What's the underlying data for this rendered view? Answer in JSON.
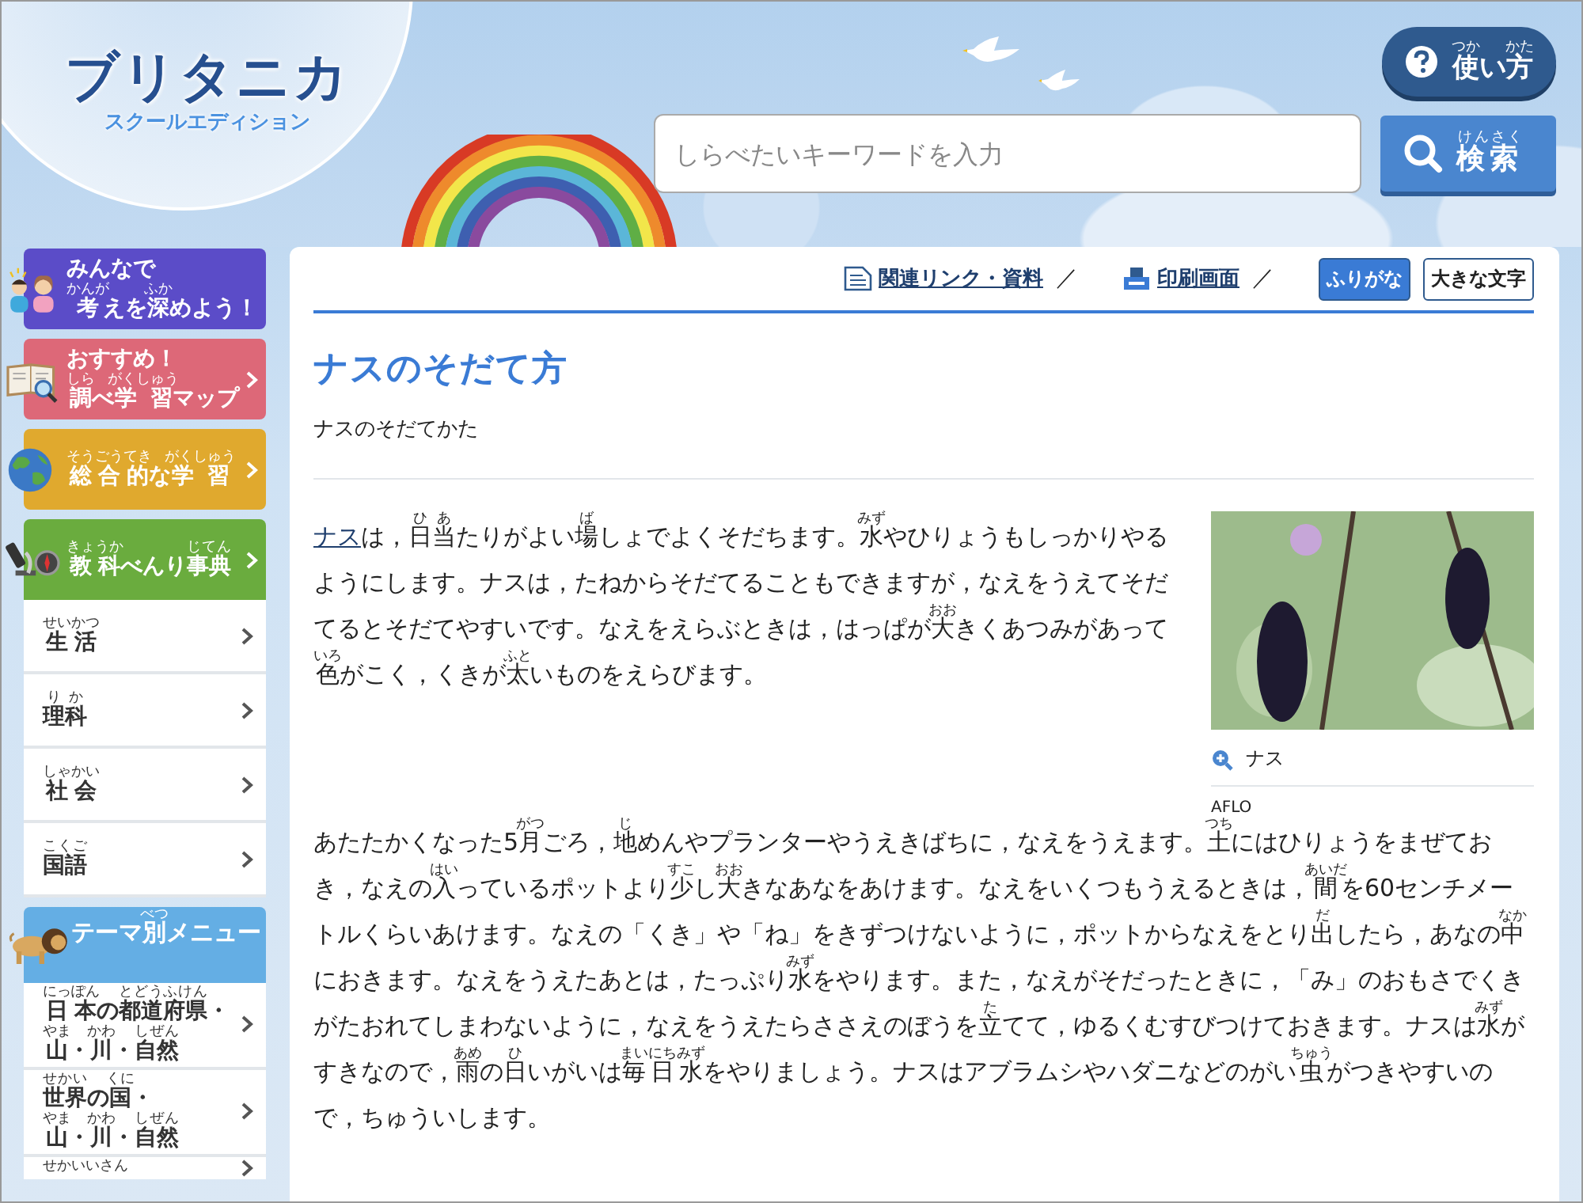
{
  "header": {
    "logo_title": "ブリタニカ",
    "logo_subtitle": "スクールエディション",
    "help_button": [
      {
        "text": "使",
        "ruby": "つか"
      },
      {
        "text": "い"
      },
      {
        "text": "方",
        "ruby": "かた"
      }
    ],
    "search": {
      "placeholder": "しらべたいキーワードを入力"
    },
    "search_button": [
      {
        "text": "検",
        "ruby": "けん"
      },
      {
        "text": "索",
        "ruby": "さく"
      }
    ]
  },
  "sidebar": {
    "items": [
      {
        "kind": "banner",
        "color": "#5b4cc8",
        "lines": [
          [
            {
              "text": "みんなで"
            }
          ],
          [
            {
              "text": "考",
              "ruby": "かんが"
            },
            {
              "text": "えを"
            },
            {
              "text": "深",
              "ruby": "ふか"
            },
            {
              "text": "めよう！"
            }
          ]
        ]
      },
      {
        "kind": "banner",
        "color": "#dd6878",
        "lines": [
          [
            {
              "text": "おすすめ！"
            }
          ],
          [
            {
              "text": "調",
              "ruby": "しら"
            },
            {
              "text": "べ"
            },
            {
              "text": "学習",
              "ruby": "がくしゅう"
            },
            {
              "text": "マップ"
            }
          ]
        ]
      },
      {
        "kind": "banner",
        "color": "#e0a92e",
        "lines": [
          [
            {
              "text": "総合的",
              "ruby": "そうごうてき"
            },
            {
              "text": "な"
            },
            {
              "text": "学習",
              "ruby": "がくしゅう"
            }
          ]
        ]
      },
      {
        "kind": "banner",
        "color": "#6aac3e",
        "lines": [
          [
            {
              "text": "教科",
              "ruby": "きょうか"
            },
            {
              "text": "べんり"
            },
            {
              "text": "事典",
              "ruby": "じてん"
            }
          ]
        ]
      },
      {
        "kind": "subject",
        "lines": [
          [
            {
              "text": "生活",
              "ruby": "せいかつ"
            }
          ]
        ]
      },
      {
        "kind": "subject",
        "lines": [
          [
            {
              "text": "理科",
              "ruby": "りか"
            }
          ]
        ]
      },
      {
        "kind": "subject",
        "lines": [
          [
            {
              "text": "社会",
              "ruby": "しゃかい"
            }
          ]
        ]
      },
      {
        "kind": "subject",
        "lines": [
          [
            {
              "text": "国語",
              "ruby": "こくご"
            }
          ]
        ]
      },
      {
        "kind": "heading",
        "color": "#64aee4",
        "lines": [
          [
            {
              "text": "テーマ"
            },
            {
              "text": "別",
              "ruby": "べつ"
            },
            {
              "text": "メニュー"
            }
          ]
        ]
      },
      {
        "kind": "subject",
        "lines": [
          [
            {
              "text": "日本",
              "ruby": "にっぽん"
            },
            {
              "text": "の"
            },
            {
              "text": "都道府県",
              "ruby": "とどうふけん"
            },
            {
              "text": "・"
            }
          ],
          [
            {
              "text": "山",
              "ruby": "やま"
            },
            {
              "text": "・"
            },
            {
              "text": "川",
              "ruby": "かわ"
            },
            {
              "text": "・"
            },
            {
              "text": "自然",
              "ruby": "しぜん"
            }
          ]
        ]
      },
      {
        "kind": "subject",
        "lines": [
          [
            {
              "text": "世界",
              "ruby": "せかい"
            },
            {
              "text": "の"
            },
            {
              "text": "国",
              "ruby": "くに"
            },
            {
              "text": "・"
            }
          ],
          [
            {
              "text": "山",
              "ruby": "やま"
            },
            {
              "text": "・"
            },
            {
              "text": "川",
              "ruby": "かわ"
            },
            {
              "text": "・"
            },
            {
              "text": "自然",
              "ruby": "しぜん"
            }
          ]
        ]
      },
      {
        "kind": "subject",
        "lines": [
          [
            {
              "ruby": "せかいいさん"
            }
          ]
        ]
      }
    ]
  },
  "article": {
    "tools": [
      {
        "kind": "resources",
        "label": "関連リンク・資料"
      },
      {
        "kind": "separator",
        "label": "／"
      },
      {
        "kind": "print",
        "label": "印刷画面"
      },
      {
        "kind": "separator",
        "label": "／"
      }
    ],
    "toggles": [
      {
        "label": "ふりがな",
        "selected": true
      },
      {
        "label": "大きな文字",
        "selected": false
      }
    ],
    "title": "ナスのそだて方",
    "subtitle": "ナスのそだてかた",
    "figure": {
      "caption": "ナス",
      "credit": "AFLO"
    },
    "paragraphs": [
      [
        {
          "text": "ナス",
          "kind": "link"
        },
        {
          "text": "は，"
        },
        {
          "text": "日",
          "ruby": "ひ"
        },
        {
          "text": "当",
          "ruby": "あ"
        },
        {
          "text": "たりがよい"
        },
        {
          "text": "場",
          "ruby": "ば"
        },
        {
          "text": "しょでよくそだちます。"
        },
        {
          "text": "水",
          "ruby": "みず"
        },
        {
          "text": "やひりょうもしっかりやるようにします。ナスは，たねからそだてることもできますが，なえをうえてそだてるとそだてやすいです。なえをえらぶときは，はっぱが"
        },
        {
          "text": "大",
          "ruby": "おお"
        },
        {
          "text": "きくあつみがあって"
        },
        {
          "text": "色",
          "ruby": "いろ"
        },
        {
          "text": "がこく，くきが"
        },
        {
          "text": "太",
          "ruby": "ふと"
        },
        {
          "text": "いものをえらびます。"
        }
      ],
      [
        {
          "text": "あたたかくなった5"
        },
        {
          "text": "月",
          "ruby": "がつ"
        },
        {
          "text": "ごろ，"
        },
        {
          "text": "地",
          "ruby": "じ"
        },
        {
          "text": "めんやプランターやうえきばちに，なえをうえます。"
        },
        {
          "text": "土",
          "ruby": "つち"
        },
        {
          "text": "にはひりょうをまぜておき，なえの"
        },
        {
          "text": "入",
          "ruby": "はい"
        },
        {
          "text": "っているポットより"
        },
        {
          "text": "少",
          "ruby": "すこ"
        },
        {
          "text": "し"
        },
        {
          "text": "大",
          "ruby": "おお"
        },
        {
          "text": "きなあなをあけます。なえをいくつもうえるときは，"
        },
        {
          "text": "間",
          "ruby": "あいだ"
        },
        {
          "text": "を60センチメートルくらいあけます。なえの「くき」や「ね」をきずつけないように，ポットからなえをとり"
        },
        {
          "text": "出",
          "ruby": "だ"
        },
        {
          "text": "したら，あなの"
        },
        {
          "text": "中",
          "ruby": "なか"
        },
        {
          "text": "におきます。なえをうえたあとは，たっぷり"
        },
        {
          "text": "水",
          "ruby": "みず"
        },
        {
          "text": "をやります。また，なえがそだったときに，「み」のおもさでくきがたおれてしまわないように，なえをうえたらささえのぼうを"
        },
        {
          "text": "立",
          "ruby": "た"
        },
        {
          "text": "てて，ゆるくむすびつけておきます。ナスは"
        },
        {
          "text": "水",
          "ruby": "みず"
        },
        {
          "text": "がすきなので，"
        },
        {
          "text": "雨",
          "ruby": "あめ"
        },
        {
          "text": "の"
        },
        {
          "text": "日",
          "ruby": "ひ"
        },
        {
          "text": "いがいは"
        },
        {
          "text": "毎",
          "ruby": "まい"
        },
        {
          "text": "日",
          "ruby": "にち"
        },
        {
          "text": "水",
          "ruby": "みず"
        },
        {
          "text": "をやりましょう。ナスはアブラムシやハダニなどのがい"
        },
        {
          "text": "虫",
          "ruby": "ちゅう"
        },
        {
          "text": "がつきやすいので，ちゅういします。"
        }
      ]
    ]
  }
}
